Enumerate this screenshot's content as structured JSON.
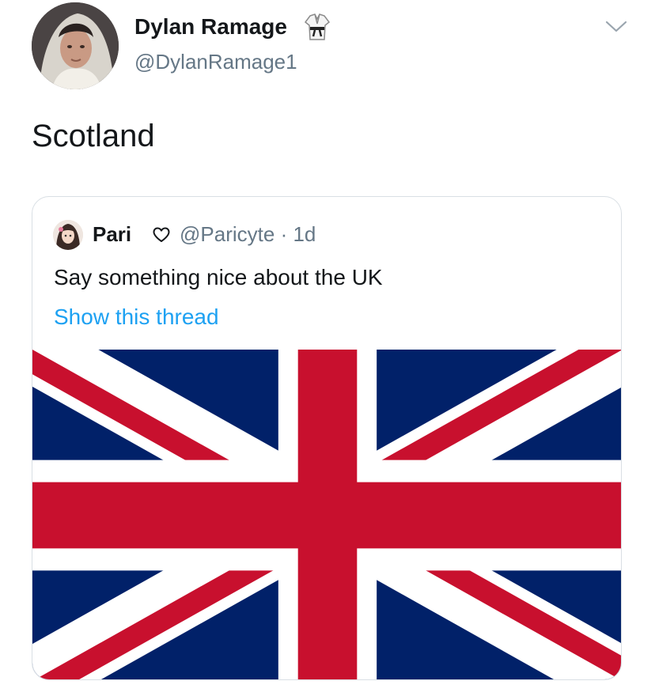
{
  "tweet": {
    "author": {
      "display_name": "Dylan Ramage",
      "handle": "@DylanRamage1",
      "name_emoji": "martial-arts-uniform-icon"
    },
    "text": "Scotland",
    "menu_icon": "chevron-down-icon"
  },
  "quoted_tweet": {
    "author": {
      "display_name": "Pari",
      "handle": "@Paricyte",
      "separator": "·",
      "time": "1d",
      "name_emoji": "heart-outline-icon"
    },
    "text": "Say something nice about the UK",
    "show_thread_label": "Show this thread",
    "media": "union-jack-flag-image"
  },
  "colors": {
    "text_primary": "#14171a",
    "text_secondary": "#657786",
    "link": "#1da1f2",
    "card_border": "#d9dfe4",
    "flag_blue": "#012169",
    "flag_red": "#C8102E",
    "flag_white": "#FFFFFF"
  }
}
